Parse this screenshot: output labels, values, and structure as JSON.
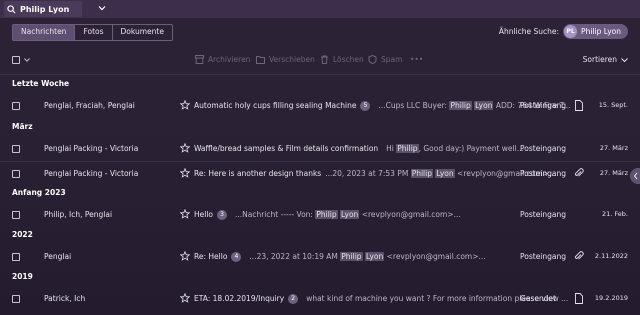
{
  "search": {
    "value": "Philip Lyon"
  },
  "tabs": [
    {
      "label": "Nachrichten",
      "active": true
    },
    {
      "label": "Fotos",
      "active": false
    },
    {
      "label": "Dokumente",
      "active": false
    }
  ],
  "similar": {
    "label": "Ähnliche Suche:",
    "avatar": "PL",
    "name": "Philip Lyon"
  },
  "toolbar": {
    "archive": "Archivieren",
    "move": "Verschieben",
    "delete": "Löschen",
    "spam": "Spam",
    "more": "•••",
    "sort": "Sortieren"
  },
  "groups": {
    "g1": "Letzte Woche",
    "g2": "März",
    "g3": "Anfang 2023",
    "g4": "2022",
    "g5": "2019"
  },
  "rows": [
    {
      "from": "Penglai, Fraciah, Penglai",
      "subject": "Automatic holy cups filling sealing Machine",
      "count": "5",
      "snip_pre": "...Cups LLC Buyer: ",
      "hl1": "Philip",
      "hl2": "Lyon",
      "snip_post": " ADD: 764 W Fire T...",
      "folder": "Posteingang",
      "date": "15. Sept."
    },
    {
      "from": "Penglai Packing - Victoria",
      "subject": "Waffle/bread samples & Film details confirmation",
      "count": "",
      "snip_pre": "Hi ",
      "hl1": "Philip",
      "hl2": "",
      "snip_post": ", Good day:) Payment well...",
      "folder": "Posteingang",
      "date": "27. März"
    },
    {
      "from": "Penglai Packing - Victoria",
      "subject": "Re: Here is another design thanks",
      "count": "",
      "snip_pre": "...20, 2023 at 7:53 PM ",
      "hl1": "Philip",
      "hl2": "Lyon",
      "snip_post": " <revplyon@gmail.com>...",
      "folder": "Posteingang",
      "date": "27. März"
    },
    {
      "from": "Philip, Ich, Penglai",
      "subject": "Hello",
      "count": "3",
      "snip_pre": "...Nachricht ----- Von: ",
      "hl1": "Philip",
      "hl2": "Lyon",
      "snip_post": " <revplyon@gmail.com>...",
      "folder": "Posteingang",
      "date": "21. Feb."
    },
    {
      "from": "Penglai",
      "subject": "Re: Hello",
      "count": "4",
      "snip_pre": "...23, 2022 at 10:19 AM ",
      "hl1": "Philip",
      "hl2": "Lyon",
      "snip_post": " <revplyon@gmail.com>...",
      "folder": "Posteingang",
      "date": "2.11.2022"
    },
    {
      "from": "Patrick, Ich",
      "subject": "ETA: 18.02.2019/Inquiry",
      "count": "2",
      "snip_pre": "what kind of machine you want ? For more information please view ...",
      "hl1": "",
      "hl2": "",
      "snip_post": "",
      "folder": "Gesendet",
      "date": "19.2.2019"
    }
  ]
}
